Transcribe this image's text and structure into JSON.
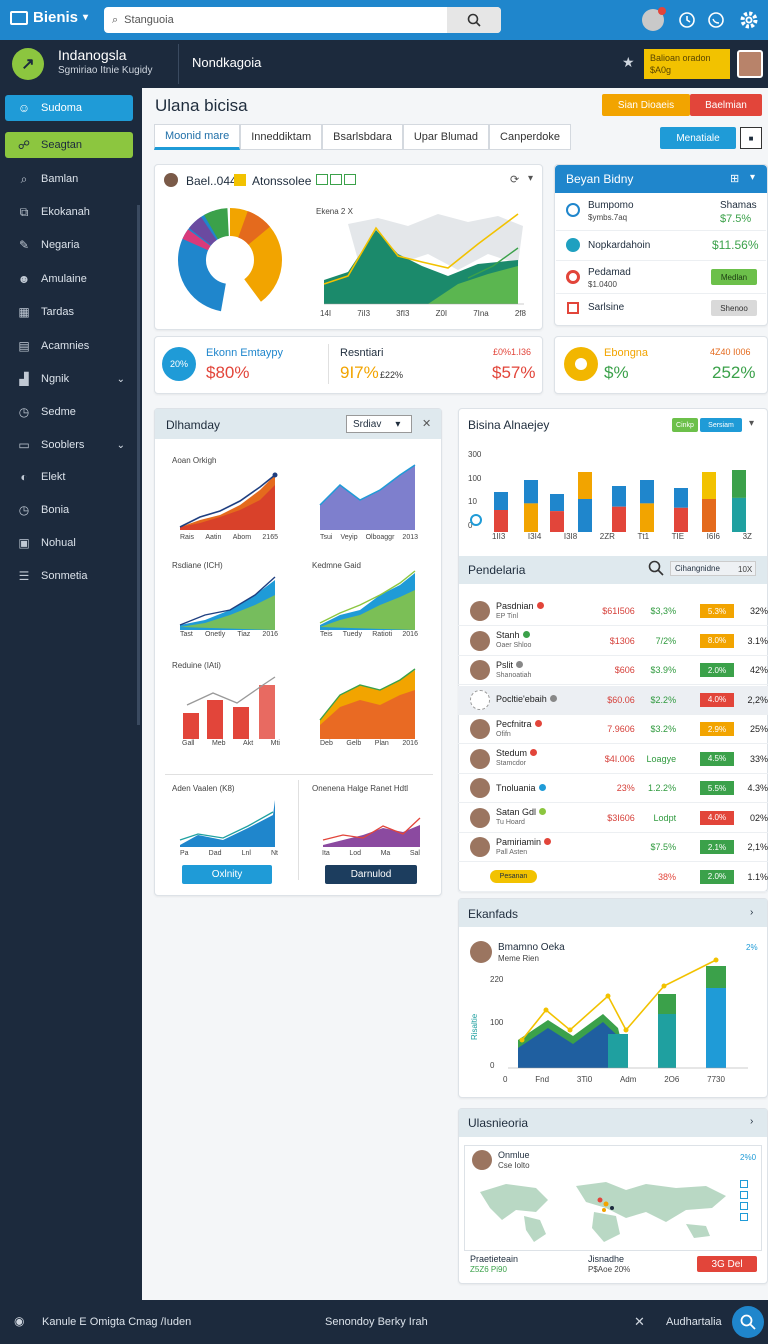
{
  "app": {
    "name": "Bienis"
  },
  "search": {
    "placeholder": "Stanguoia"
  },
  "org": {
    "name": "Indanogsla",
    "subtitle": "Sgmiriao Itnie Kugidy"
  },
  "header": {
    "title": "Nondkagoia",
    "badge": "Balioan oradon $A0g"
  },
  "sidebar": {
    "items": [
      {
        "label": "Sudoma",
        "icon": "users-icon",
        "active": "blue"
      },
      {
        "label": "Seagtan",
        "icon": "group-icon",
        "active": "green"
      },
      {
        "label": "Bamlan",
        "icon": "search-icon"
      },
      {
        "label": "Ekokanah",
        "icon": "external-icon"
      },
      {
        "label": "Negaria",
        "icon": "tool-icon"
      },
      {
        "label": "Amulaine",
        "icon": "people-icon"
      },
      {
        "label": "Tardas",
        "icon": "grid-icon"
      },
      {
        "label": "Acamnies",
        "icon": "document-icon"
      },
      {
        "label": "Ngnik",
        "icon": "chart-icon",
        "chevron": true
      },
      {
        "label": "Sedme",
        "icon": "clock-icon"
      },
      {
        "label": "Sooblers",
        "icon": "folder-icon",
        "chevron": true
      },
      {
        "label": "Elekt",
        "icon": "info-icon"
      },
      {
        "label": "Bonia",
        "icon": "clock-icon"
      },
      {
        "label": "Nohual",
        "icon": "camera-icon"
      },
      {
        "label": "Sonmetia",
        "icon": "list-icon"
      }
    ]
  },
  "page": {
    "title": "Ulana bicisa",
    "btn_orange": "Sian Dioaeis",
    "btn_red": "Baelmian",
    "btn_manage": "Menatiale"
  },
  "tabs": [
    "Moonid mare",
    "Inneddiktam",
    "Bsarlsbdara",
    "Upar Blumad",
    "Canperdoke"
  ],
  "overview": {
    "title": "Bael..044",
    "tag": "Atonssolee",
    "chart_caption": "Ekena 2 X",
    "x_ticks": [
      "14I",
      "7iI3",
      "3fI3",
      "Z0I",
      "7Ina",
      "2f8"
    ]
  },
  "kpi1": {
    "ring": "20%",
    "label": "Ekonn Emtaypy",
    "value": "$80%",
    "label2": "Resntiari",
    "value2": "9I7%",
    "sub2": "£22%",
    "top3": "£0%1.I36",
    "value3": "$57%"
  },
  "kpi2": {
    "label": "Ebongna",
    "value": "$%",
    "top": "4Z40 I006",
    "value2": "252%"
  },
  "bayan": {
    "title": "Beyan Bidny",
    "rows": [
      {
        "label": "Bumpomo",
        "sub": "$ymbs.7aq",
        "right_top": "Shamas",
        "right": "$7.5%"
      },
      {
        "label": "Nopkardahoin",
        "right": "$11.56%"
      },
      {
        "label": "Pedamad",
        "sub": "$1.0400",
        "btn": "Medlan"
      },
      {
        "label": "Sarlsine",
        "btn": "Shenoo"
      }
    ]
  },
  "dashboard": {
    "title": "Dlhamday",
    "select": "Srdiav",
    "mini": [
      {
        "title": "Aoan Orkigh",
        "ticks": [
          "Rais",
          "Aatin",
          "Abom",
          "2165"
        ]
      },
      {
        "title": "",
        "ticks": [
          "Tsui",
          "Veyip",
          "Olboaggr",
          "2013"
        ]
      },
      {
        "title": "Rsdiane (ICH)",
        "ticks": [
          "Tast",
          "Onetly",
          "Tiaz",
          "2016"
        ]
      },
      {
        "title": "Kedmne Gaid",
        "ticks": [
          "Teis",
          "Tuedy",
          "Ratioti",
          "2016"
        ]
      },
      {
        "title": "Reduine (IAti)",
        "ticks": [
          "Gall",
          "Meb",
          "Akt",
          "Mti"
        ]
      },
      {
        "title": "",
        "ticks": [
          "Deb",
          "Gelb",
          "Plan",
          "2016"
        ]
      },
      {
        "title": "Aden Vaalen (K8)",
        "ticks": [
          "Pa",
          "Dad",
          "Lnl",
          "Nt"
        ]
      },
      {
        "title": "Onenena Halge Ranet Hdtl",
        "ticks": [
          "Ita",
          "Lod",
          "Ma",
          "Sal"
        ]
      }
    ],
    "btn_left": "Oxlnity",
    "btn_right": "Darnulod"
  },
  "bisina": {
    "title": "Bisina Alnaejey",
    "pill1": "Cinkp",
    "pill2": "Sersiam",
    "y_ticks": [
      "300",
      "100",
      "10",
      "0"
    ],
    "x_ticks": [
      "1II3",
      "I3I4",
      "I3I8",
      "2ZR",
      "Tt1",
      "TIE",
      "I6I6",
      "3Z"
    ]
  },
  "pendel": {
    "title": "Pendelaria",
    "search": "Cihangnidne",
    "count": "10X",
    "rows": [
      {
        "name": "Pasdnian",
        "sub": "EP Tinl",
        "dot": "#e2453a",
        "v1": "$61I506",
        "v2": "$3,3%",
        "badge": "5.3%",
        "bc": "#f2a400",
        "pct": "32%"
      },
      {
        "name": "Stanh",
        "sub": "Oaer Shloo",
        "dot": "#3ba14a",
        "v1": "$1306",
        "v2": "7/2%",
        "badge": "8.0%",
        "bc": "#f2a400",
        "pct": "3.1%"
      },
      {
        "name": "Pslit",
        "sub": "Shanoatiah",
        "dot": "#888888",
        "v1": "$606",
        "v2": "$3.9%",
        "badge": "2.0%",
        "bc": "#3ba14a",
        "pct": "42%"
      },
      {
        "name": "Pocltie'ebaih",
        "sub": "",
        "dot": "#888888",
        "v1": "$60.06",
        "v2": "$2.2%",
        "badge": "4.0%",
        "bc": "#e2453a",
        "pct": "2,2%",
        "hl": true
      },
      {
        "name": "Pecfnitra",
        "sub": "Ofifn",
        "dot": "#e2453a",
        "v1": "7.9606",
        "v2": "$3.2%",
        "badge": "2.9%",
        "bc": "#f2a400",
        "pct": "25%"
      },
      {
        "name": "Stedum",
        "sub": "Stamcdor",
        "dot": "#e2453a",
        "v1": "$4I.006",
        "v2": "Loagye",
        "badge": "4.5%",
        "bc": "#3ba14a",
        "pct": "33%"
      },
      {
        "name": "Tnoluania",
        "sub": "",
        "dot": "#1f9bd7",
        "v1": "23%",
        "v2": "1.2.2%",
        "badge": "5.5%",
        "bc": "#3ba14a",
        "pct": "4.3%"
      },
      {
        "name": "Satan Gdl",
        "sub": "Tu Hoard",
        "dot": "#8cc63f",
        "v1": "$3I606",
        "v2": "Lodpt",
        "badge": "4.0%",
        "bc": "#e2453a",
        "pct": "02%"
      },
      {
        "name": "Pamiriamin",
        "sub": "Pall Asten",
        "dot": "#e2453a",
        "v1": "",
        "v2": "$7.5%",
        "badge": "2.1%",
        "bc": "#3ba14a",
        "pct": "2,1%"
      },
      {
        "name": "Pesanan",
        "sub": "",
        "dot": "",
        "v1": "",
        "v2": "38%",
        "badge": "2.0%",
        "bc": "#3ba14a",
        "pct": "1.1%"
      }
    ]
  },
  "ekanfads": {
    "title": "Ekanfads",
    "name": "Bmamno Oeka",
    "sub": "Meme Rien",
    "top": "2%",
    "y_ticks": [
      "220",
      "100",
      "0"
    ],
    "x_ticks": [
      "0",
      "Fnd",
      "3Ti0",
      "Adm",
      "2O6",
      "7730"
    ],
    "ylabel": "Risaltie"
  },
  "ulasn": {
    "title": "Ulasnieoria",
    "name": "Onmlue",
    "sub": "Cse Iolto",
    "top": "2%0",
    "foot_left": "Praetieteain",
    "foot_left_sub": "Z5Z6 Pi90",
    "foot_mid": "Jisnadhe",
    "foot_mid_sub": "P$Aoe 20%",
    "btn": "3G Del"
  },
  "footer": {
    "left": "Kanule E Omigta Cmag /Iuden",
    "mid": "Senondoy Berky Irah",
    "right": "Audhartalia"
  },
  "colors": {
    "blue": "#1f86cc",
    "navy": "#1c2a3d",
    "green": "#8cc63f",
    "orange": "#f2a400",
    "red": "#e2453a",
    "teal": "#1fa0a0"
  }
}
